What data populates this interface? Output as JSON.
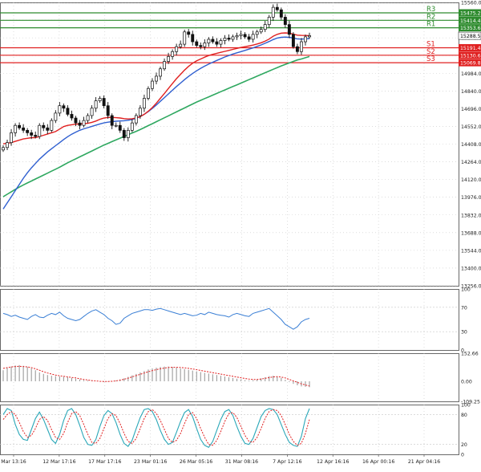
{
  "chart_data": {
    "type": "line",
    "main": {
      "ylim": [
        13256.0,
        15560.0
      ],
      "y_ticks": [
        "15560.0",
        "15416.0",
        "15272.0",
        "15128.0",
        "14984.0",
        "14840.0",
        "14696.0",
        "14552.0",
        "14408.0",
        "14264.0",
        "14120.0",
        "13976.0",
        "13832.0",
        "13688.0",
        "13544.0",
        "13400.0",
        "13256.0"
      ],
      "last_price": "15288.5",
      "close": [
        14380,
        14420,
        14500,
        14560,
        14540,
        14520,
        14500,
        14480,
        14470,
        14560,
        14540,
        14520,
        14600,
        14660,
        14720,
        14700,
        14650,
        14620,
        14580,
        14560,
        14600,
        14640,
        14700,
        14760,
        14780,
        14720,
        14640,
        14560,
        14560,
        14520,
        14460,
        14520,
        14580,
        14640,
        14700,
        14780,
        14860,
        14920,
        14960,
        15020,
        15080,
        15120,
        15160,
        15200,
        15220,
        15320,
        15300,
        15240,
        15210,
        15200,
        15230,
        15260,
        15240,
        15220,
        15250,
        15270,
        15260,
        15280,
        15290,
        15300,
        15280,
        15260,
        15300,
        15320,
        15340,
        15380,
        15440,
        15520,
        15500,
        15440,
        15380,
        15300,
        15200,
        15160,
        15240,
        15280,
        15290
      ],
      "ema_red": [
        14410,
        14415,
        14420,
        14430,
        14440,
        14450,
        14455,
        14460,
        14460,
        14470,
        14480,
        14490,
        14500,
        14510,
        14530,
        14550,
        14560,
        14565,
        14570,
        14572,
        14574,
        14578,
        14585,
        14595,
        14610,
        14620,
        14625,
        14625,
        14623,
        14620,
        14615,
        14612,
        14614,
        14620,
        14632,
        14650,
        14675,
        14705,
        14740,
        14780,
        14820,
        14860,
        14900,
        14940,
        14975,
        15010,
        15040,
        15065,
        15085,
        15100,
        15115,
        15128,
        15138,
        15146,
        15154,
        15162,
        15170,
        15178,
        15186,
        15194,
        15200,
        15206,
        15213,
        15222,
        15232,
        15245,
        15262,
        15285,
        15300,
        15310,
        15312,
        15310,
        15302,
        15294,
        15292,
        15291,
        15290
      ],
      "ema_blue": [
        13880,
        13930,
        13980,
        14030,
        14080,
        14130,
        14175,
        14215,
        14250,
        14285,
        14315,
        14345,
        14370,
        14395,
        14420,
        14445,
        14468,
        14488,
        14505,
        14520,
        14532,
        14542,
        14552,
        14562,
        14572,
        14580,
        14586,
        14590,
        14594,
        14596,
        14598,
        14602,
        14608,
        14618,
        14632,
        14650,
        14672,
        14698,
        14726,
        14756,
        14786,
        14816,
        14846,
        14876,
        14904,
        14932,
        14958,
        14982,
        15004,
        15024,
        15042,
        15058,
        15074,
        15088,
        15102,
        15116,
        15128,
        15140,
        15150,
        15160,
        15170,
        15180,
        15190,
        15202,
        15214,
        15228,
        15242,
        15258,
        15270,
        15276,
        15278,
        15276,
        15270,
        15264,
        15262,
        15264,
        15266
      ],
      "ema_green": [
        13980,
        14000,
        14020,
        14040,
        14058,
        14076,
        14092,
        14108,
        14124,
        14140,
        14156,
        14172,
        14188,
        14204,
        14220,
        14238,
        14256,
        14272,
        14288,
        14304,
        14320,
        14336,
        14352,
        14368,
        14384,
        14400,
        14414,
        14428,
        14442,
        14456,
        14470,
        14484,
        14498,
        14512,
        14526,
        14542,
        14558,
        14574,
        14590,
        14606,
        14622,
        14638,
        14654,
        14670,
        14686,
        14702,
        14718,
        14734,
        14750,
        14764,
        14778,
        14792,
        14806,
        14820,
        14834,
        14848,
        14862,
        14876,
        14890,
        14904,
        14918,
        14932,
        14946,
        14960,
        14974,
        14988,
        15002,
        15016,
        15030,
        15044,
        15056,
        15068,
        15080,
        15092,
        15100,
        15110,
        15120
      ],
      "levels": [
        {
          "name": "R3",
          "value": 15475.2,
          "label": "15475.2",
          "color": "#2e8b2e"
        },
        {
          "name": "R2",
          "value": 15414.4,
          "label": "15414.4",
          "color": "#2e8b2e"
        },
        {
          "name": "R1",
          "value": 15353.6,
          "label": "15353.6",
          "color": "#2e8b2e"
        },
        {
          "name": "S1",
          "value": 15191.4,
          "label": "15191.4",
          "color": "#e02020"
        },
        {
          "name": "S2",
          "value": 15130.6,
          "label": "15130.6",
          "color": "#e02020"
        },
        {
          "name": "S3",
          "value": 15069.8,
          "label": "15069.8",
          "color": "#e02020"
        }
      ]
    },
    "rsi": {
      "ylim": [
        0,
        100
      ],
      "y_ticks": [
        "100",
        "70",
        "30",
        "0"
      ],
      "values": [
        60,
        58,
        55,
        57,
        54,
        52,
        50,
        55,
        58,
        54,
        53,
        57,
        60,
        58,
        62,
        56,
        52,
        50,
        48,
        50,
        55,
        60,
        64,
        66,
        62,
        58,
        52,
        48,
        42,
        44,
        52,
        56,
        60,
        62,
        64,
        66,
        66,
        65,
        67,
        68,
        66,
        64,
        62,
        60,
        58,
        60,
        58,
        56,
        57,
        60,
        58,
        62,
        60,
        58,
        57,
        56,
        54,
        58,
        60,
        58,
        56,
        55,
        60,
        62,
        64,
        66,
        68,
        62,
        56,
        50,
        42,
        38,
        34,
        38,
        46,
        50,
        52
      ]
    },
    "macd": {
      "ylim": [
        -109.25,
        152.66
      ],
      "y_ticks": [
        "152.66",
        "0.00",
        "-109.25"
      ],
      "histogram": [
        60,
        72,
        80,
        86,
        88,
        84,
        78,
        70,
        60,
        48,
        40,
        34,
        30,
        28,
        26,
        24,
        22,
        18,
        14,
        10,
        6,
        4,
        2,
        0,
        -2,
        -4,
        -2,
        0,
        4,
        10,
        16,
        24,
        32,
        40,
        48,
        56,
        64,
        70,
        74,
        78,
        80,
        80,
        78,
        74,
        70,
        66,
        62,
        58,
        54,
        50,
        46,
        42,
        38,
        34,
        30,
        26,
        22,
        18,
        14,
        10,
        6,
        4,
        6,
        10,
        16,
        22,
        28,
        30,
        26,
        18,
        8,
        -4,
        -14,
        -22,
        -28,
        -30,
        -32
      ],
      "signal": [
        70,
        74,
        78,
        80,
        81,
        80,
        78,
        74,
        68,
        60,
        52,
        45,
        39,
        34,
        30,
        27,
        24,
        21,
        18,
        14,
        10,
        7,
        4,
        2,
        0,
        -1,
        -1,
        0,
        2,
        6,
        11,
        17,
        24,
        31,
        38,
        45,
        52,
        58,
        63,
        68,
        72,
        75,
        76,
        76,
        75,
        73,
        70,
        67,
        63,
        59,
        55,
        51,
        47,
        43,
        39,
        35,
        31,
        27,
        23,
        19,
        15,
        12,
        10,
        10,
        12,
        16,
        20,
        24,
        25,
        23,
        18,
        10,
        2,
        -6,
        -14,
        -20,
        -26
      ]
    },
    "stoch": {
      "ylim": [
        0,
        100
      ],
      "y_ticks": [
        "100",
        "80",
        "20",
        "0"
      ],
      "k": [
        80,
        92,
        88,
        60,
        40,
        30,
        28,
        50,
        72,
        85,
        70,
        50,
        30,
        22,
        40,
        68,
        88,
        92,
        80,
        58,
        34,
        20,
        18,
        30,
        56,
        78,
        88,
        82,
        64,
        40,
        22,
        16,
        28,
        52,
        74,
        90,
        92,
        86,
        70,
        48,
        30,
        20,
        24,
        44,
        66,
        84,
        90,
        76,
        52,
        30,
        18,
        14,
        26,
        48,
        70,
        86,
        90,
        78,
        56,
        36,
        22,
        20,
        32,
        54,
        76,
        88,
        92,
        90,
        80,
        60,
        40,
        24,
        18,
        16,
        36,
        72,
        92
      ],
      "d": [
        70,
        80,
        86,
        80,
        64,
        46,
        34,
        38,
        52,
        70,
        76,
        68,
        50,
        34,
        30,
        42,
        64,
        82,
        86,
        78,
        60,
        40,
        24,
        22,
        32,
        52,
        72,
        82,
        78,
        62,
        42,
        26,
        22,
        32,
        52,
        72,
        86,
        90,
        82,
        68,
        50,
        32,
        24,
        28,
        42,
        62,
        80,
        84,
        72,
        52,
        34,
        20,
        18,
        28,
        46,
        66,
        82,
        84,
        74,
        56,
        38,
        26,
        24,
        34,
        52,
        72,
        86,
        90,
        88,
        78,
        60,
        40,
        26,
        18,
        22,
        42,
        70
      ]
    },
    "x_ticks": [
      "Mar 13:16",
      "12 Mar 17:16",
      "17 Mar 17:16",
      "23 Mar 01:16",
      "26 Mar 05:16",
      "31 Mar 08:16",
      "7 Apr 12:16",
      "12 Apr 16:16",
      "16 Apr 00:16",
      "21 Apr 04:16"
    ],
    "colors": {
      "candle": "#111111",
      "ema_red": "#e02020",
      "ema_blue": "#2f5fd0",
      "ema_green": "#2fa860",
      "rsi": "#3a7fd5",
      "macd_hist": "#9a9a9a",
      "macd_signal": "#e02020",
      "stoch_k": "#2aa7b8",
      "stoch_d": "#e02020",
      "grid": "#c8c8c8",
      "price_box": "#ffffff"
    }
  }
}
